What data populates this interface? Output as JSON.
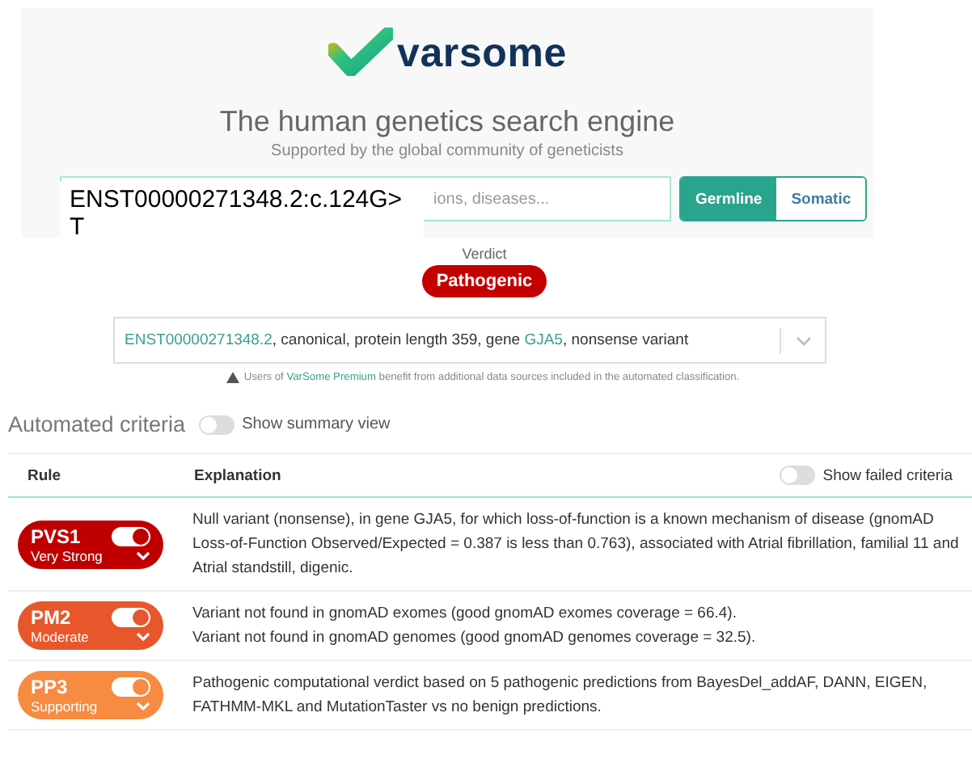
{
  "header": {
    "logo_text": "varsome",
    "title": "The human genetics search engine",
    "subtitle": "Supported by the global community of geneticists"
  },
  "search": {
    "placeholder": "ions, diseases...",
    "overlay_text": "ENST00000271348.2:c.124G>T",
    "modes": [
      {
        "label": "Germline",
        "selected": true
      },
      {
        "label": "Somatic",
        "selected": false
      }
    ]
  },
  "verdict": {
    "label": "Verdict",
    "value": "Pathogenic"
  },
  "transcript": {
    "id": "ENST00000271348.2",
    "text_1": ", canonical, protein length 359, gene ",
    "gene": "GJA5",
    "text_2": ", nonsense variant"
  },
  "notice": {
    "text_1": "Users of ",
    "link": "VarSome Premium",
    "text_2": " benefit from additional data sources included in the automated classification."
  },
  "criteria_section": {
    "title": "Automated criteria",
    "summary_toggle": {
      "label": "Show summary view",
      "on": false
    }
  },
  "table": {
    "columns": [
      "Rule",
      "Explanation"
    ],
    "failed_toggle": {
      "label": "Show failed criteria",
      "on": false
    },
    "rows": [
      {
        "code": "PVS1",
        "strength": "Very Strong",
        "color": "#c00000",
        "on": true,
        "explanation": [
          "Null variant (nonsense), in gene GJA5, for which loss-of-function is a known mechanism of disease (gnomAD Loss-of-Function Observed/Expected = 0.387 is less than 0.763), associated with Atrial fibrillation, familial 11 and Atrial standstill, digenic."
        ]
      },
      {
        "code": "PM2",
        "strength": "Moderate",
        "color": "#e8562c",
        "on": true,
        "explanation": [
          "Variant not found in gnomAD exomes (good gnomAD exomes coverage = 66.4).",
          "Variant not found in gnomAD genomes (good gnomAD genomes coverage = 32.5)."
        ]
      },
      {
        "code": "PP3",
        "strength": "Supporting",
        "color": "#f68b41",
        "on": true,
        "explanation": [
          "Pathogenic computational verdict based on 5 pathogenic predictions from BayesDel_addAF, DANN, EIGEN, FATHMM-MKL and MutationTaster vs no benign predictions."
        ]
      }
    ]
  }
}
